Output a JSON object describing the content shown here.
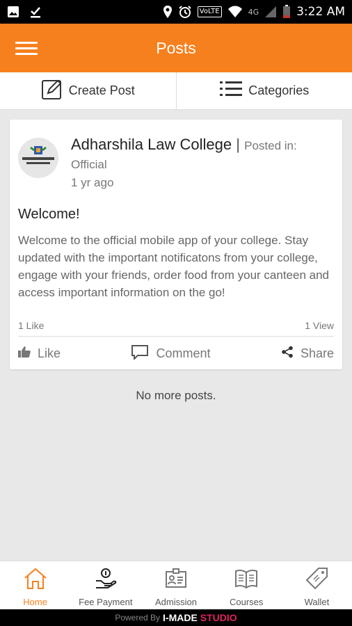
{
  "status_bar": {
    "time": "3:22 AM",
    "icons": [
      "image-icon",
      "download-done-icon",
      "location-icon",
      "alarm-icon",
      "volte-icon",
      "wifi-icon",
      "signal-icon",
      "battery-icon"
    ],
    "volte": "VoLTE",
    "network": "4G"
  },
  "app_bar": {
    "title": "Posts",
    "menu_icon": "hamburger-menu-icon",
    "color": "#f7801e"
  },
  "toolbar": {
    "create_post": "Create Post",
    "categories": "Categories"
  },
  "post": {
    "author": "Adharshila Law College",
    "separator": "|",
    "posted_in_label": "Posted in:",
    "category": "Official",
    "time_ago": "1 yr ago",
    "title": "Welcome!",
    "body": "Welcome to the official mobile app of your college. Stay updated with the important notificatons from your college, engage with your friends, order food from your canteen and access important information on the go!",
    "likes_count": "1 Like",
    "views_count": "1 View",
    "actions": {
      "like": "Like",
      "comment": "Comment",
      "share": "Share"
    }
  },
  "feed_end": "No more posts.",
  "bottom_nav": [
    {
      "label": "Home",
      "icon": "home-icon",
      "active": true
    },
    {
      "label": "Fee Payment",
      "icon": "fee-payment-icon",
      "active": false
    },
    {
      "label": "Admission",
      "icon": "admission-icon",
      "active": false
    },
    {
      "label": "Courses",
      "icon": "courses-icon",
      "active": false
    },
    {
      "label": "Wallet",
      "icon": "wallet-icon",
      "active": false
    }
  ],
  "footer": {
    "powered_by": "Powered By",
    "brand": "I-MADE",
    "studio": "STUDIO"
  }
}
